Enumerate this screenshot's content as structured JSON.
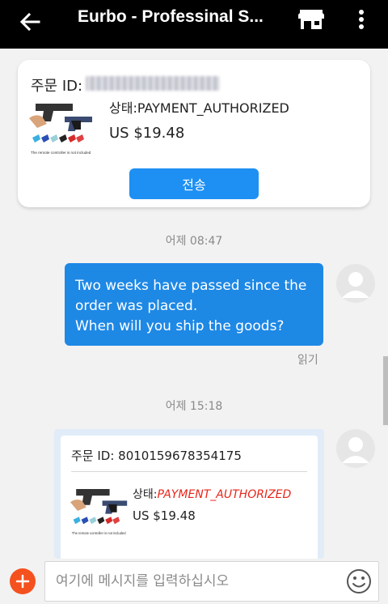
{
  "header": {
    "title": "Eurbo - Professinal S...",
    "back_icon": "arrow-left-icon",
    "store_icon": "store-icon",
    "more_icon": "more-vertical-icon"
  },
  "order_card": {
    "order_id_label": "주문 ID:",
    "order_id_masked": true,
    "status": "상태:PAYMENT_AUTHORIZED",
    "price": "US $19.48",
    "image_caption": "The remote controller is not included",
    "send_button": "전송"
  },
  "messages": [
    {
      "time": "어제 08:47",
      "lines": [
        "Two weeks have passed since the",
        "order was placed.",
        "When will you ship the goods?"
      ],
      "read_status": "읽기"
    },
    {
      "time": "어제 15:18",
      "order_id": "주문 ID: 8010159678354175",
      "status_label": "상태:",
      "status_value": "PAYMENT_AUTHORIZED",
      "price": "US $19.48",
      "image_caption": "The remote controller is not included"
    }
  ],
  "input": {
    "placeholder": "여기에 메시지를 입력하십시오",
    "plus_icon": "plus-icon",
    "emoji_icon": "smiley-icon"
  },
  "colors": {
    "accent": "#1e88e5",
    "status_red": "#e8261a",
    "plus_orange": "#f4511e"
  }
}
